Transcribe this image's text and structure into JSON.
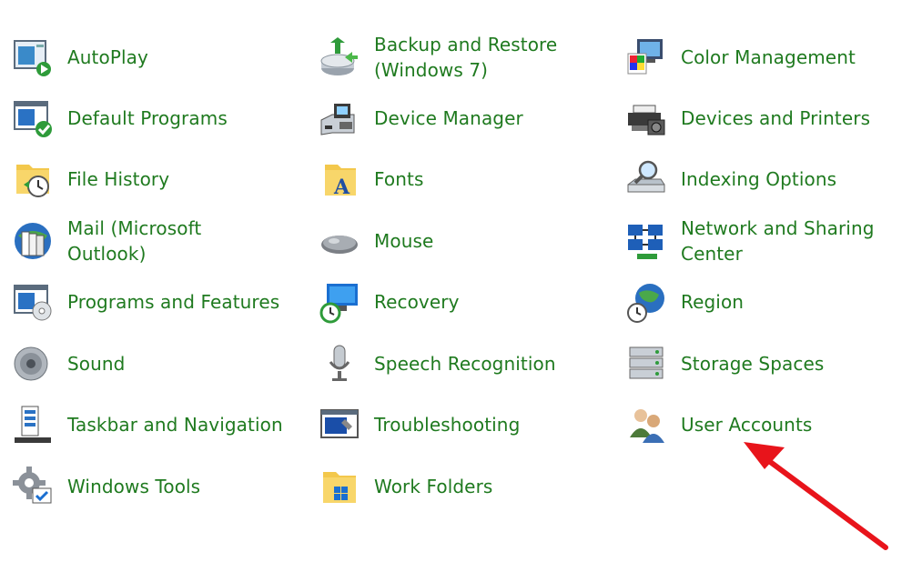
{
  "items": [
    {
      "label": "AutoPlay",
      "icon": "autoplay-icon"
    },
    {
      "label": "Backup and Restore\n(Windows 7)",
      "icon": "backup-restore-icon"
    },
    {
      "label": "Color Management",
      "icon": "color-management-icon"
    },
    {
      "label": "Default Programs",
      "icon": "default-programs-icon"
    },
    {
      "label": "Device Manager",
      "icon": "device-manager-icon"
    },
    {
      "label": "Devices and Printers",
      "icon": "printer-icon"
    },
    {
      "label": "File History",
      "icon": "file-history-icon"
    },
    {
      "label": "Fonts",
      "icon": "fonts-icon"
    },
    {
      "label": "Indexing Options",
      "icon": "indexing-options-icon"
    },
    {
      "label": "Mail (Microsoft Outlook)",
      "icon": "mail-icon"
    },
    {
      "label": "Mouse",
      "icon": "mouse-icon"
    },
    {
      "label": "Network and Sharing\nCenter",
      "icon": "network-icon"
    },
    {
      "label": "Programs and Features",
      "icon": "programs-features-icon"
    },
    {
      "label": "Recovery",
      "icon": "recovery-icon"
    },
    {
      "label": "Region",
      "icon": "region-globe-icon"
    },
    {
      "label": "Sound",
      "icon": "speaker-icon"
    },
    {
      "label": "Speech Recognition",
      "icon": "microphone-icon"
    },
    {
      "label": "Storage Spaces",
      "icon": "storage-spaces-icon"
    },
    {
      "label": "Taskbar and Navigation",
      "icon": "taskbar-icon"
    },
    {
      "label": "Troubleshooting",
      "icon": "troubleshooting-icon"
    },
    {
      "label": "User Accounts",
      "icon": "user-accounts-icon"
    },
    {
      "label": "Windows Tools",
      "icon": "windows-tools-icon"
    },
    {
      "label": "Work Folders",
      "icon": "work-folders-icon"
    }
  ],
  "colors": {
    "link": "#1f7a1f",
    "arrow": "#e8141b"
  }
}
